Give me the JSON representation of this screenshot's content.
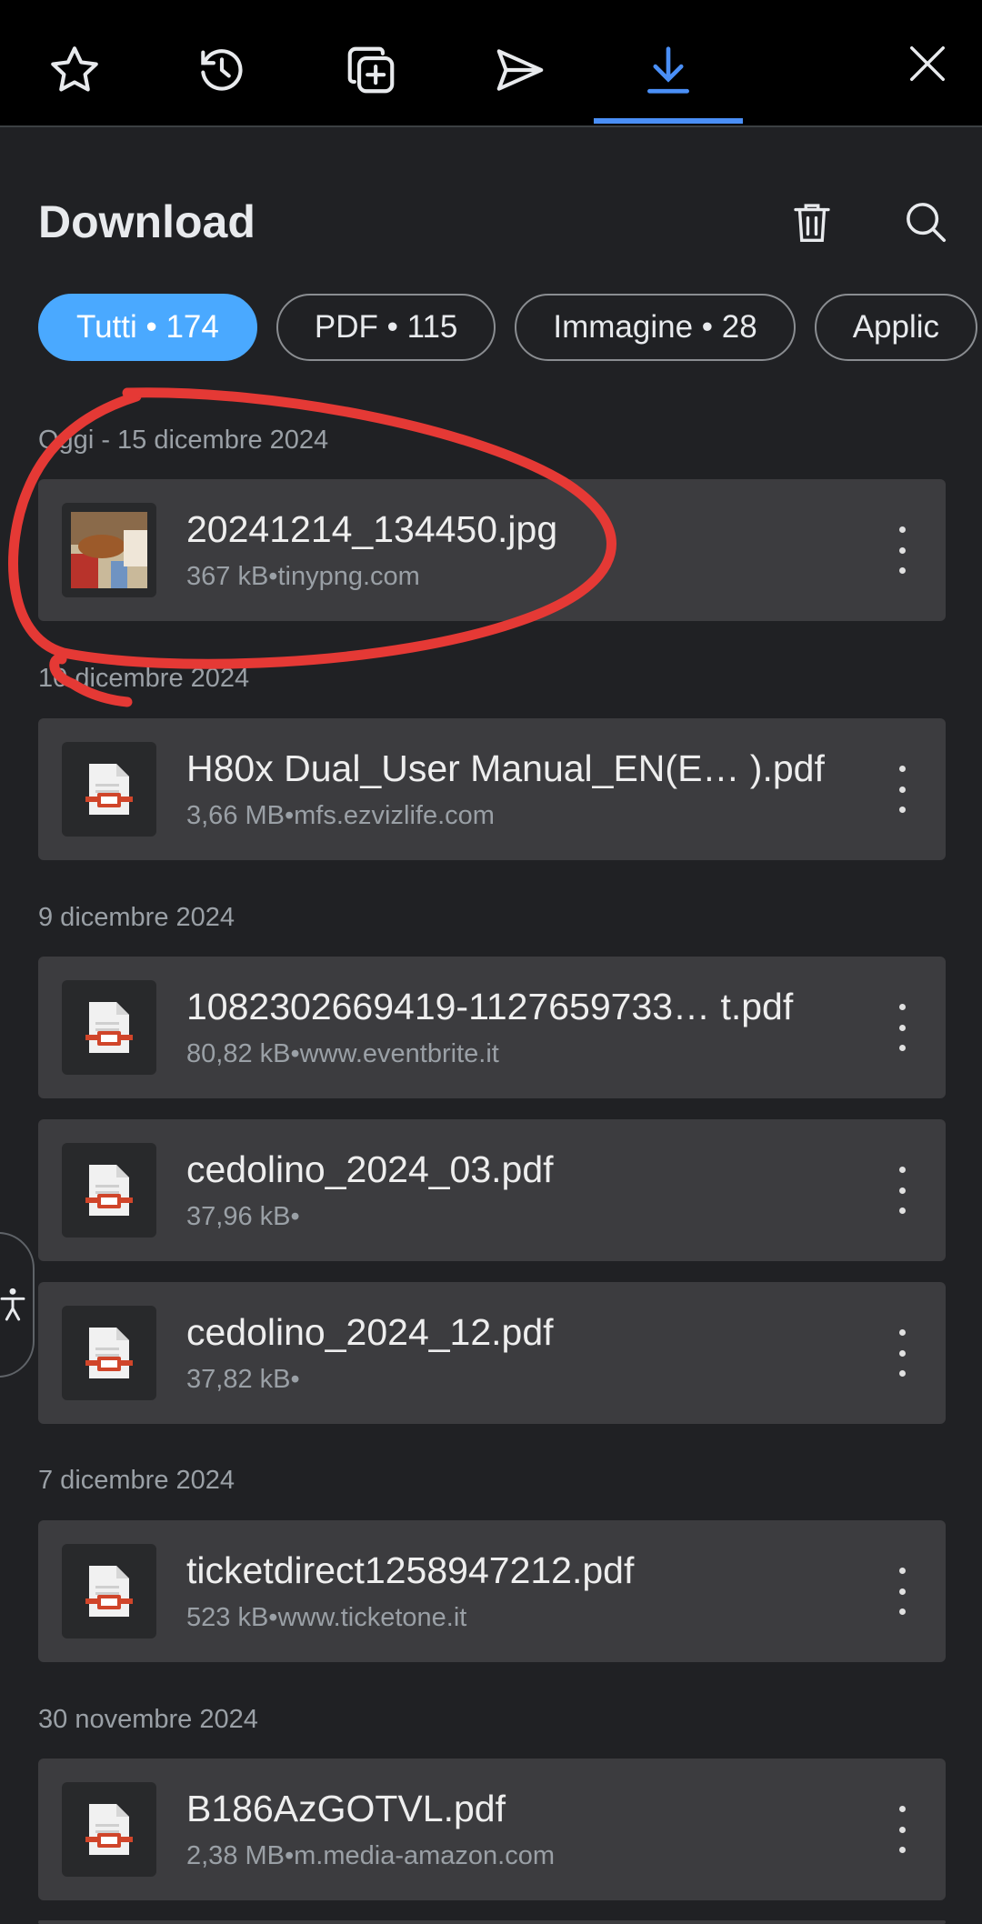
{
  "tabs": [
    {
      "icon": "star-icon",
      "name": "tab-favorites"
    },
    {
      "icon": "history-icon",
      "name": "tab-history"
    },
    {
      "icon": "add-tab-icon",
      "name": "tab-new"
    },
    {
      "icon": "send-icon",
      "name": "tab-send"
    },
    {
      "icon": "download-icon",
      "name": "tab-downloads",
      "active": true
    }
  ],
  "header": {
    "title": "Download"
  },
  "filters": [
    {
      "label": "Tutti • 174",
      "active": true
    },
    {
      "label": "PDF • 115"
    },
    {
      "label": "Immagine • 28"
    },
    {
      "label": "Applic"
    }
  ],
  "sections": [
    {
      "label": "Oggi - 15 dicembre 2024",
      "items": [
        {
          "name": "20241214_134450.jpg",
          "meta": "367 kB•tinypng.com",
          "type": "image"
        }
      ]
    },
    {
      "label": "10 dicembre 2024",
      "items": [
        {
          "name": "H80x Dual_User Manual_EN(E… ).pdf",
          "meta": "3,66 MB•mfs.ezvizlife.com",
          "type": "pdf"
        }
      ]
    },
    {
      "label": "9 dicembre 2024",
      "items": [
        {
          "name": "1082302669419-1127659733… t.pdf",
          "meta": "80,82 kB•www.eventbrite.it",
          "type": "pdf"
        },
        {
          "name": "cedolino_2024_03.pdf",
          "meta": "37,96 kB•",
          "type": "pdf"
        },
        {
          "name": "cedolino_2024_12.pdf",
          "meta": "37,82 kB•",
          "type": "pdf"
        }
      ]
    },
    {
      "label": "7 dicembre 2024",
      "items": [
        {
          "name": "ticketdirect1258947212.pdf",
          "meta": "523 kB•www.ticketone.it",
          "type": "pdf"
        }
      ]
    },
    {
      "label": "30 novembre 2024",
      "items": [
        {
          "name": "B186AzGOTVL.pdf",
          "meta": "2,38 MB•m.media-amazon.com",
          "type": "pdf"
        }
      ]
    }
  ],
  "colors": {
    "accent": "#4aa9ff",
    "tab_active": "#4a8ff7",
    "annotation": "#e53935",
    "pdf": "#d0452a"
  }
}
